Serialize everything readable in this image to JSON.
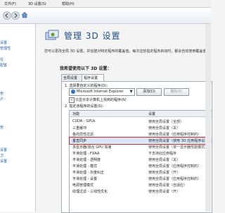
{
  "menubar": {
    "items": [
      "文件(F)",
      "3D 设置(S)",
      "帮助(H)"
    ]
  },
  "sidebar": {
    "items": [
      "设置",
      "管理性",
      "在",
      "配置",
      "色",
      "户",
      "",
      "色",
      "",
      "设置",
      "卫",
      "设置"
    ]
  },
  "main": {
    "title": "管理 3D 设置",
    "description": "您可以更改全局 3D 设置，并创建对特定程序的覆盖值。每次这些指定程序启动时，都会自动使用覆盖值。",
    "section_heading": "我希望使用以下 3D 设置：",
    "tabs": [
      "全局设置",
      "程序设置"
    ],
    "step1_label": "1. 选择要自定义的程序(O)：",
    "program_selected": "Microsoft Internet Explorer",
    "add_label": "添加(D)",
    "remove_label": "删除(E)",
    "checkbox_checked": "✓",
    "only_show_label": "只显示本计算机上找到的程序(N)",
    "step2_label": "2. 指定该程序的设置(S)：",
    "col_feature": "功能",
    "col_setting": "设置",
    "rows": [
      {
        "feature": "CUDA - GPUs",
        "setting": "使用全局设置（全部）"
      },
      {
        "feature": "三重缓冲",
        "setting": "使用全局设置（关）"
      },
      {
        "feature": "各向异性过滤",
        "setting": "使用全局设置（应用程序控制的）"
      },
      {
        "feature": "垂直同步",
        "setting": "使用全局设置（使用 3D 应用程序设置）"
      },
      {
        "feature": "多显示器/混合 GPU 加速",
        "setting": "使用全局设置（单一显示器性能模式）"
      },
      {
        "feature": "平滑处理 - FXAA",
        "setting": "不支持此应用程序"
      },
      {
        "feature": "平滑处理 - 透明度",
        "setting": "使用全局设置（关）"
      },
      {
        "feature": "平滑处理 - 模式",
        "setting": "使用全局设置（应用程序控制的）"
      },
      {
        "feature": "平滑处理 - 灰度纠正",
        "setting": "使用全局设置（开）"
      },
      {
        "feature": "平滑处理 - 设置",
        "setting": "使用全局设置（应用程序控制的）"
      },
      {
        "feature": "电源管理模式",
        "setting": "使用全局设置（自适应）"
      },
      {
        "feature": "纹理过滤 - 三线性优化",
        "setting": "使用全局设置（开）"
      }
    ],
    "selected_row_feature": "垂直同步",
    "selected_row_setting": "使用全局设置（使用 3D 应用程序设置）"
  }
}
